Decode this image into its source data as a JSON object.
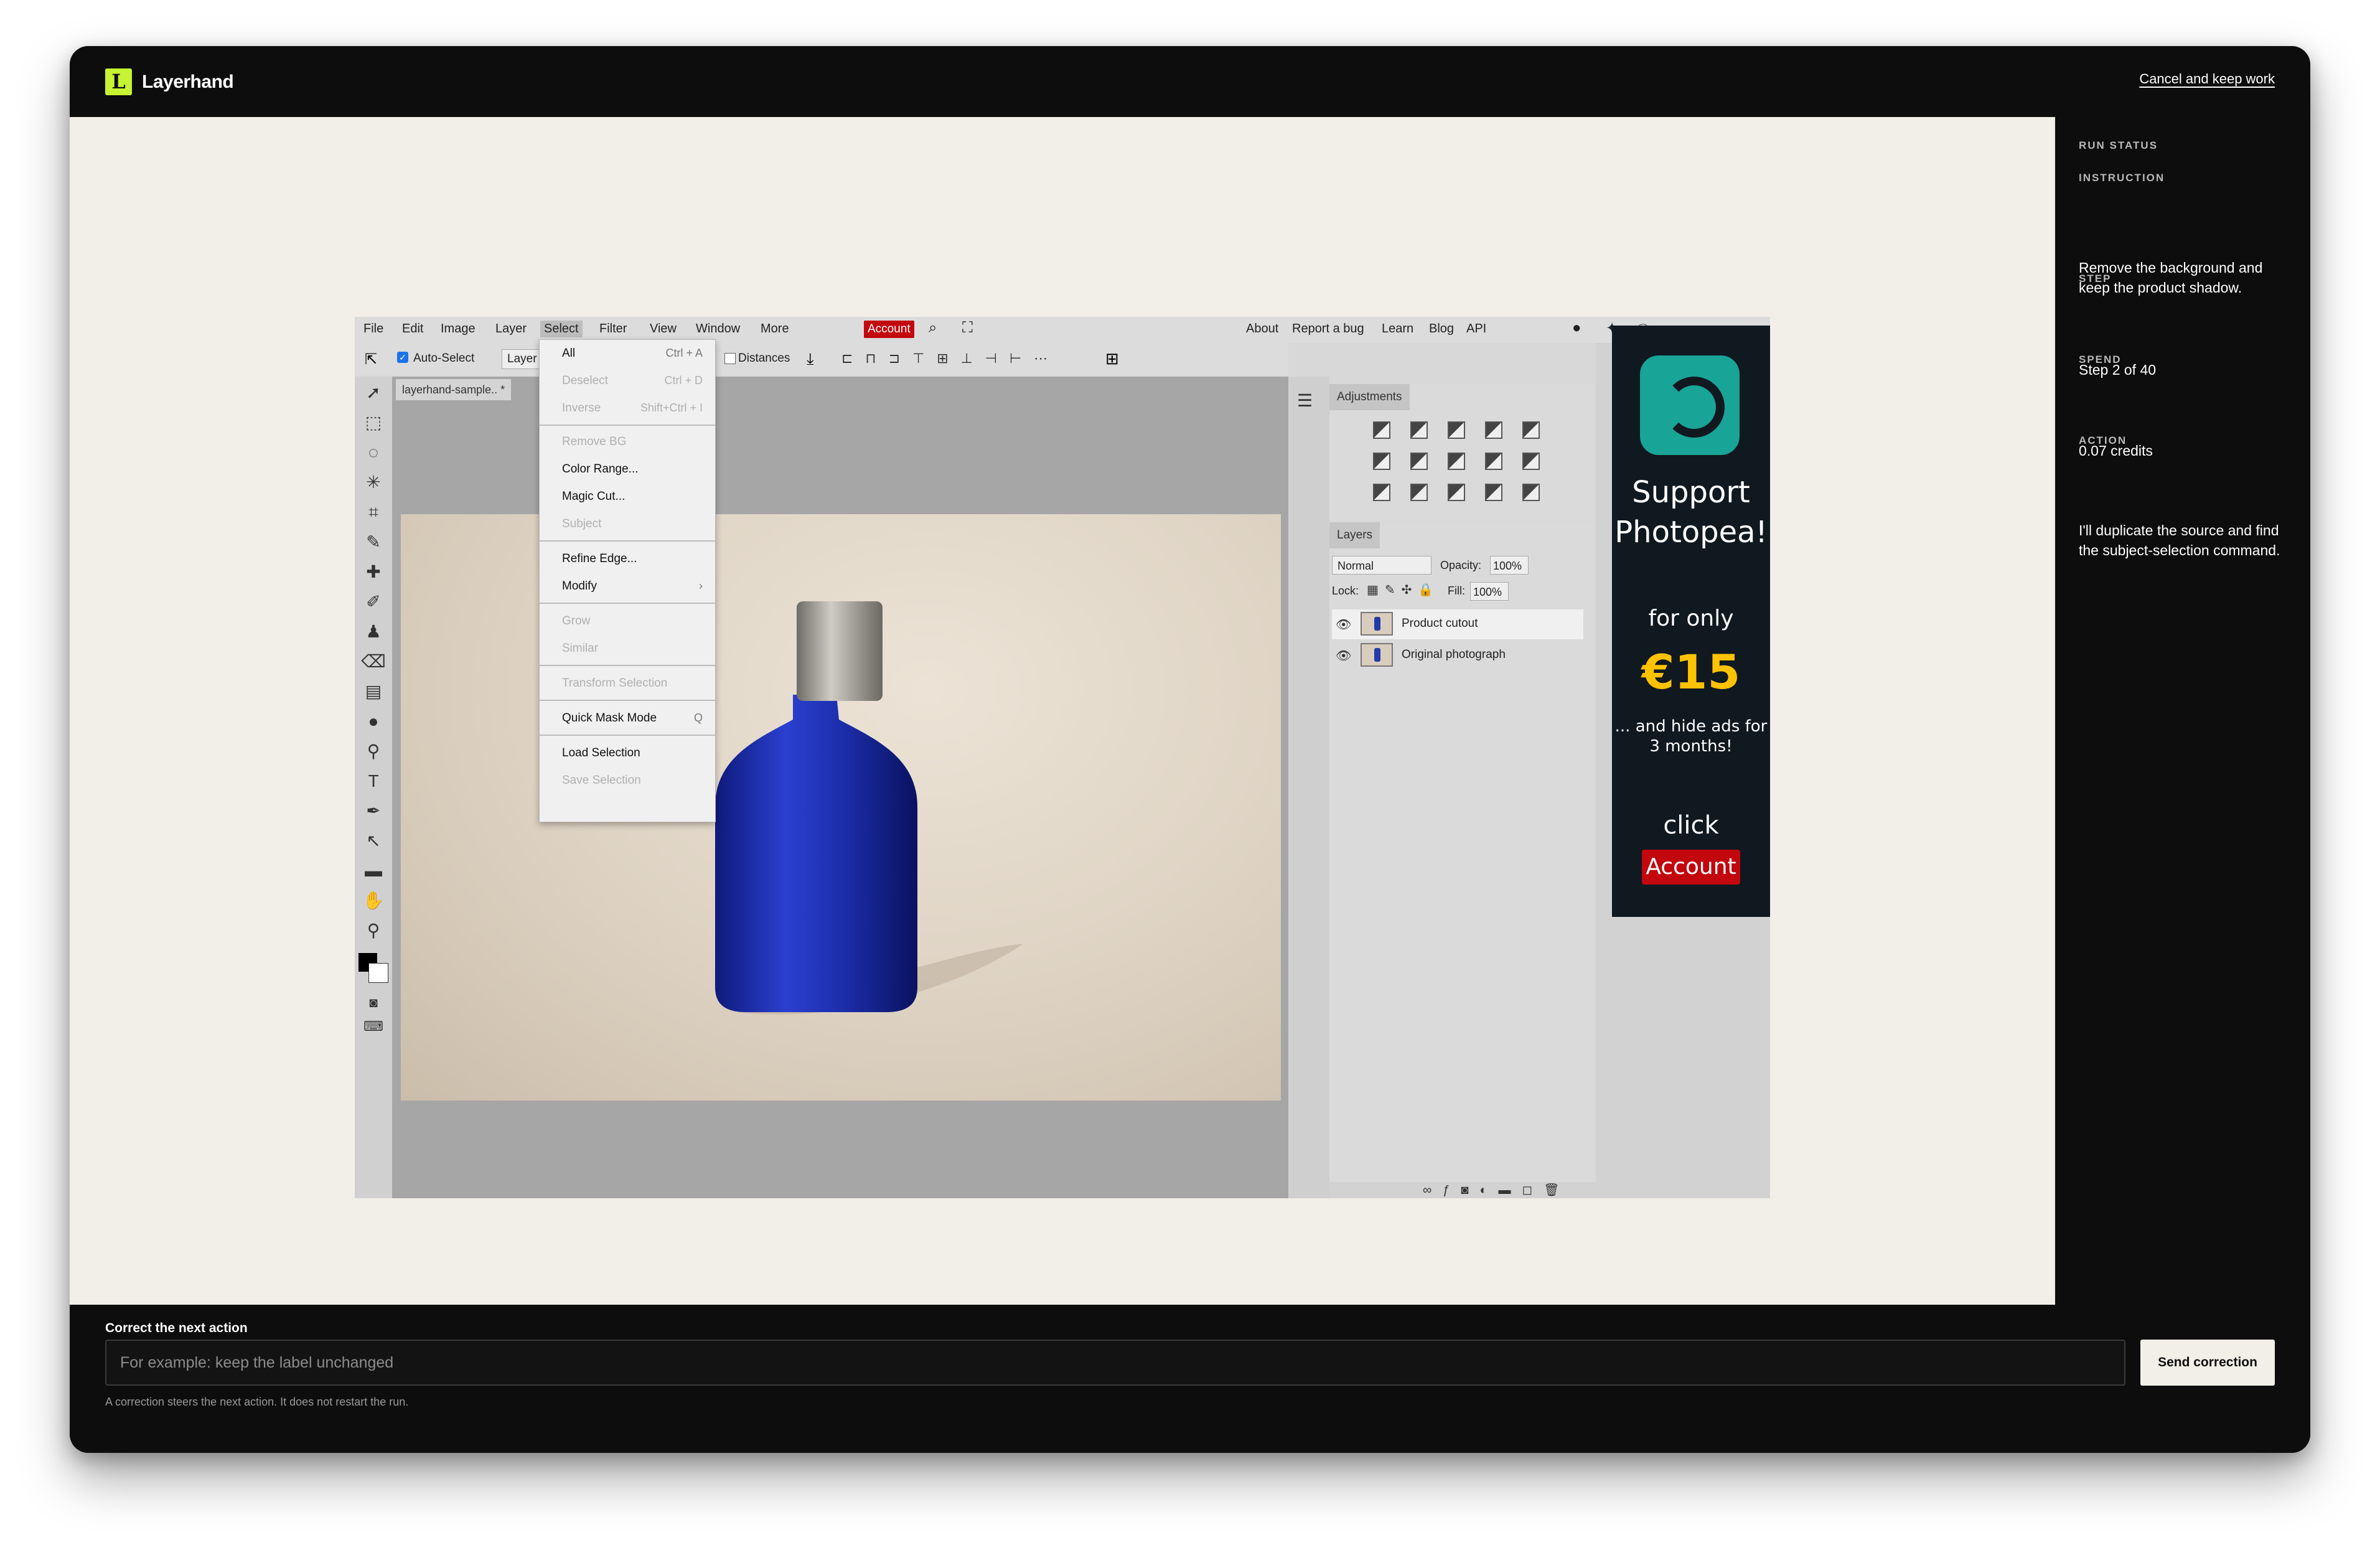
{
  "app": {
    "logo_letter": "L",
    "name": "Layerhand",
    "cancel_label": "Cancel and keep work"
  },
  "status": {
    "heading": "RUN STATUS",
    "instruction_label": "INSTRUCTION",
    "instruction": "Remove the background and keep the product shadow.",
    "step_label": "STEP",
    "step": "Step 2 of 40",
    "spend_label": "SPEND",
    "spend": "0.07 credits",
    "action_label": "ACTION",
    "action": "I'll duplicate the source and find the subject-selection command."
  },
  "correction": {
    "label": "Correct the next action",
    "placeholder": "For example: keep the label unchanged",
    "send_label": "Send correction",
    "hint": "A correction steers the next action. It does not restart the run."
  },
  "photopea": {
    "menu": [
      "File",
      "Edit",
      "Image",
      "Layer",
      "Select",
      "Filter",
      "View",
      "Window",
      "More"
    ],
    "account": "Account",
    "right_links": [
      "About",
      "Report a bug",
      "Learn",
      "Blog",
      "API"
    ],
    "options": {
      "auto_select": "Auto-Select",
      "layer_dropdown": "Layer",
      "distances": "Distances"
    },
    "doc_tab": "layerhand-sample.. *",
    "select_menu": [
      {
        "label": "All",
        "key": "Ctrl + A",
        "disabled": false
      },
      {
        "label": "Deselect",
        "key": "Ctrl + D",
        "disabled": true
      },
      {
        "label": "Inverse",
        "key": "Shift+Ctrl + I",
        "disabled": true
      },
      {
        "label": "Remove BG",
        "key": "",
        "disabled": true
      },
      {
        "label": "Color Range...",
        "key": "",
        "disabled": false
      },
      {
        "label": "Magic Cut...",
        "key": "",
        "disabled": false
      },
      {
        "label": "Subject",
        "key": "",
        "disabled": true
      },
      {
        "label": "Refine Edge...",
        "key": "",
        "disabled": false
      },
      {
        "label": "Modify",
        "key": "›",
        "disabled": false
      },
      {
        "label": "Grow",
        "key": "",
        "disabled": true
      },
      {
        "label": "Similar",
        "key": "",
        "disabled": true
      },
      {
        "label": "Transform Selection",
        "key": "",
        "disabled": true
      },
      {
        "label": "Quick Mask Mode",
        "key": "Q",
        "disabled": false
      },
      {
        "label": "Load Selection",
        "key": "",
        "disabled": false
      },
      {
        "label": "Save Selection",
        "key": "",
        "disabled": true
      }
    ],
    "adjustments_tab": "Adjustments",
    "layers_tab": "Layers",
    "blend_mode": "Normal",
    "opacity_label": "Opacity:",
    "opacity": "100%",
    "lock_label": "Lock:",
    "fill_label": "Fill:",
    "fill": "100%",
    "layers": [
      "Product cutout",
      "Original photograph"
    ],
    "ad": {
      "line1": "Support",
      "line2": "Photopea!",
      "for_only": "for only",
      "price": "€15",
      "note": "... and hide ads for 3 months!",
      "click": "click",
      "button": "Account"
    }
  },
  "colors": {
    "accent": "#c6f432",
    "stage": "#f1efe8",
    "panel": "#0d0d0d",
    "ad_price": "#ffc200",
    "account_red": "#c3070e"
  }
}
